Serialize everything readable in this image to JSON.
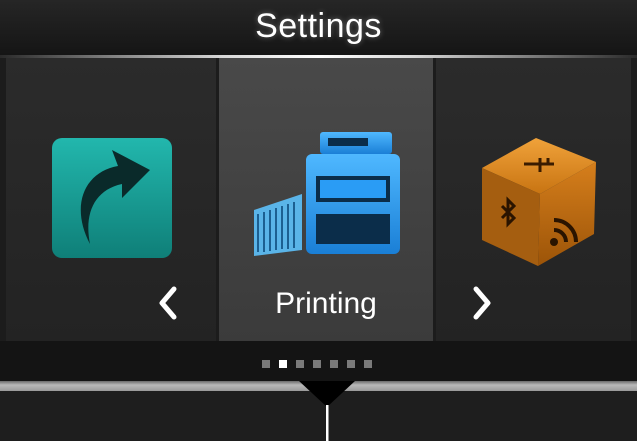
{
  "header": {
    "title": "Settings"
  },
  "carousel": {
    "items": [
      {
        "icon": "shortcut-arrow-icon",
        "label": ""
      },
      {
        "icon": "printer-icon",
        "label": "Printing"
      },
      {
        "icon": "interface-cube-icon",
        "label": ""
      }
    ],
    "selected_index": 1,
    "prev_icon": "chevron-left-icon",
    "next_icon": "chevron-right-icon"
  },
  "pager": {
    "total": 7,
    "active_index": 1
  },
  "colors": {
    "shortcut_teal": "#1aa39a",
    "printer_blue": "#2aa0ff",
    "interface_orange": "#d9831b"
  }
}
